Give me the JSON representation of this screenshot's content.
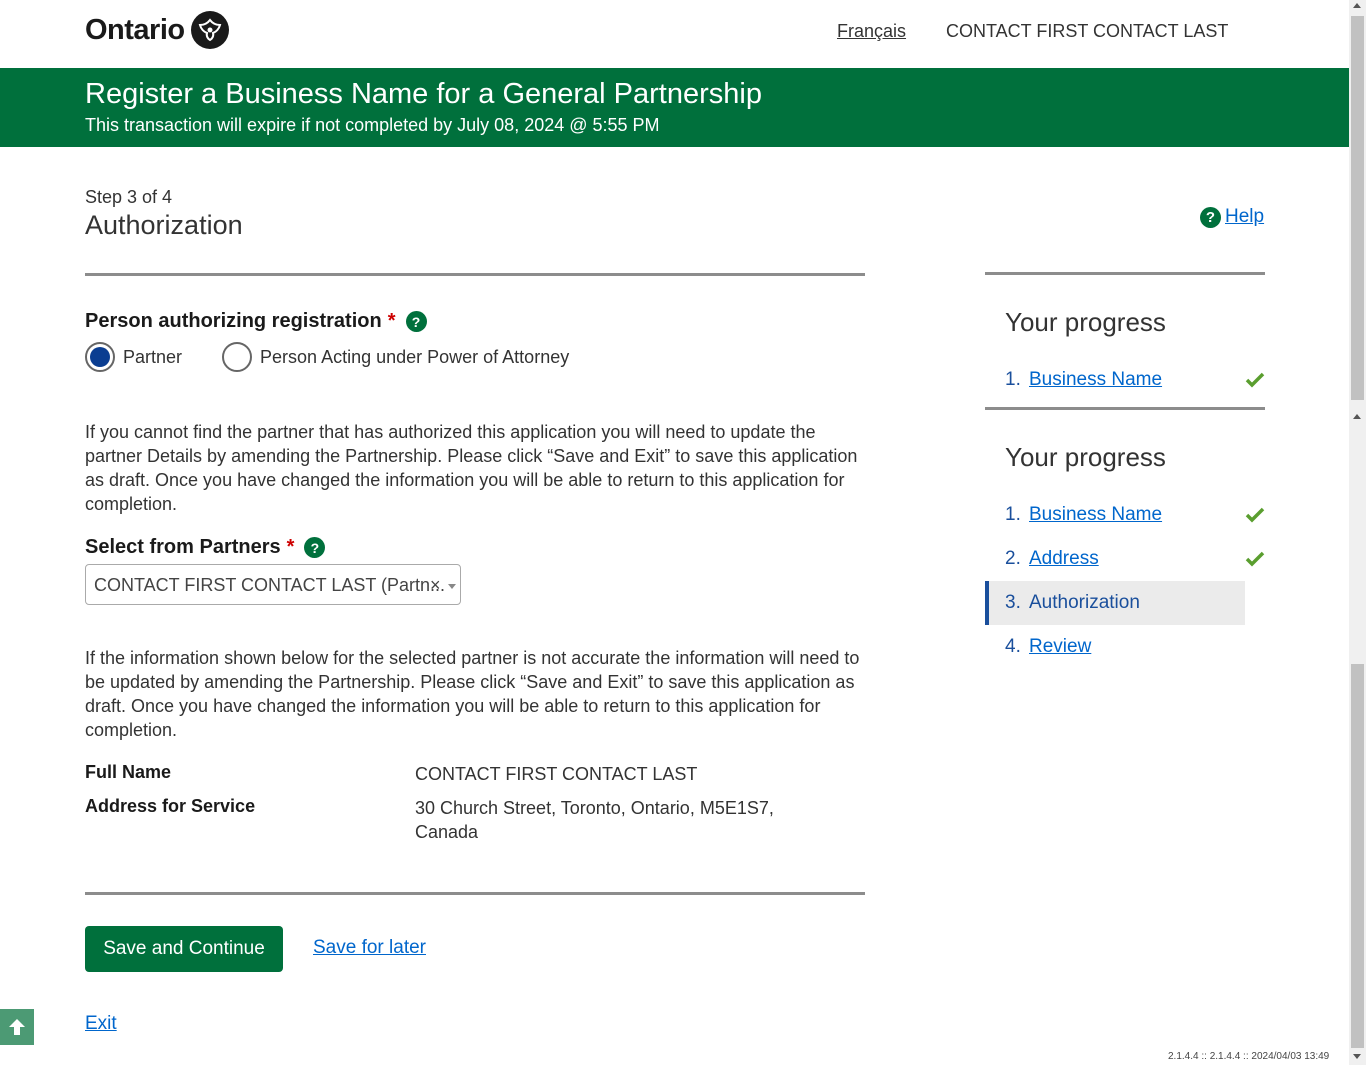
{
  "header": {
    "logo_text": "Ontario",
    "language_link": "Français",
    "user_name": "CONTACT FIRST CONTACT LAST"
  },
  "banner": {
    "title": "Register a Business Name for a General Partnership",
    "subtitle": "This transaction will expire if not completed by July 08, 2024 @ 5:55 PM"
  },
  "page": {
    "step": "Step 3 of 4",
    "title": "Authorization",
    "help_link": "Help",
    "help_icon": "?"
  },
  "authorizing": {
    "label": "Person authorizing registration",
    "required_mark": "*",
    "options": [
      {
        "label": "Partner",
        "checked": true
      },
      {
        "label": "Person Acting under Power of Attorney",
        "checked": false
      }
    ]
  },
  "info1": "If you cannot find the partner that has authorized this application you will need to update the partner Details by amending the Partnership. Please click “Save and Exit” to save this application as draft. Once you have changed the information you will be able to return to this application for completion.",
  "partners": {
    "label": "Select from Partners",
    "required_mark": "*",
    "selected": "CONTACT FIRST CONTACT LAST (Partn...",
    "clear": "×"
  },
  "info2": "If the information shown below for the selected partner is not accurate the information will need to be updated by amending the Partnership. Please click “Save and Exit” to save this application as draft. Once you have changed the information you will be able to return to this application for completion.",
  "details": {
    "full_name_label": "Full Name",
    "full_name_value": "CONTACT FIRST CONTACT LAST",
    "address_label": "Address for Service",
    "address_value": "30 Church Street, Toronto, Ontario, M5E1S7, Canada"
  },
  "actions": {
    "save_continue": "Save and Continue",
    "save_later": "Save for later",
    "exit": "Exit"
  },
  "progress_panels": [
    {
      "title": "Your progress",
      "items": [
        {
          "num": "1.",
          "label": "Business Name",
          "done": true
        }
      ]
    },
    {
      "title": "Your progress",
      "items": [
        {
          "num": "1.",
          "label": "Business Name",
          "done": true
        },
        {
          "num": "2.",
          "label": "Address",
          "done": true
        },
        {
          "num": "3.",
          "label": "Authorization",
          "current": true
        },
        {
          "num": "4.",
          "label": "Review"
        }
      ]
    }
  ],
  "footer": {
    "version": "2.1.4.4 :: 2.1.4.4 :: 2024/04/03 13:49"
  },
  "colors": {
    "brand_green": "#00703c",
    "link_blue": "#0066cc",
    "check_green": "#5a9e2f",
    "required_red": "#cd0000"
  }
}
